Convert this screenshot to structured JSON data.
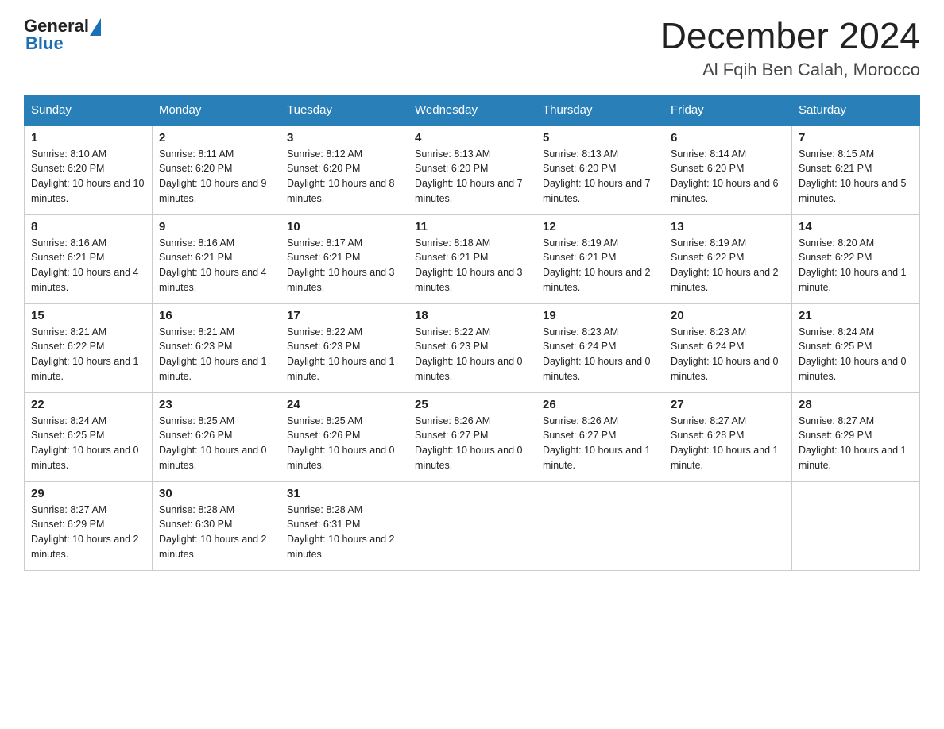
{
  "logo": {
    "general": "General",
    "blue": "Blue"
  },
  "header": {
    "month": "December 2024",
    "location": "Al Fqih Ben Calah, Morocco"
  },
  "weekdays": [
    "Sunday",
    "Monday",
    "Tuesday",
    "Wednesday",
    "Thursday",
    "Friday",
    "Saturday"
  ],
  "weeks": [
    [
      {
        "day": "1",
        "sunrise": "Sunrise: 8:10 AM",
        "sunset": "Sunset: 6:20 PM",
        "daylight": "Daylight: 10 hours and 10 minutes."
      },
      {
        "day": "2",
        "sunrise": "Sunrise: 8:11 AM",
        "sunset": "Sunset: 6:20 PM",
        "daylight": "Daylight: 10 hours and 9 minutes."
      },
      {
        "day": "3",
        "sunrise": "Sunrise: 8:12 AM",
        "sunset": "Sunset: 6:20 PM",
        "daylight": "Daylight: 10 hours and 8 minutes."
      },
      {
        "day": "4",
        "sunrise": "Sunrise: 8:13 AM",
        "sunset": "Sunset: 6:20 PM",
        "daylight": "Daylight: 10 hours and 7 minutes."
      },
      {
        "day": "5",
        "sunrise": "Sunrise: 8:13 AM",
        "sunset": "Sunset: 6:20 PM",
        "daylight": "Daylight: 10 hours and 7 minutes."
      },
      {
        "day": "6",
        "sunrise": "Sunrise: 8:14 AM",
        "sunset": "Sunset: 6:20 PM",
        "daylight": "Daylight: 10 hours and 6 minutes."
      },
      {
        "day": "7",
        "sunrise": "Sunrise: 8:15 AM",
        "sunset": "Sunset: 6:21 PM",
        "daylight": "Daylight: 10 hours and 5 minutes."
      }
    ],
    [
      {
        "day": "8",
        "sunrise": "Sunrise: 8:16 AM",
        "sunset": "Sunset: 6:21 PM",
        "daylight": "Daylight: 10 hours and 4 minutes."
      },
      {
        "day": "9",
        "sunrise": "Sunrise: 8:16 AM",
        "sunset": "Sunset: 6:21 PM",
        "daylight": "Daylight: 10 hours and 4 minutes."
      },
      {
        "day": "10",
        "sunrise": "Sunrise: 8:17 AM",
        "sunset": "Sunset: 6:21 PM",
        "daylight": "Daylight: 10 hours and 3 minutes."
      },
      {
        "day": "11",
        "sunrise": "Sunrise: 8:18 AM",
        "sunset": "Sunset: 6:21 PM",
        "daylight": "Daylight: 10 hours and 3 minutes."
      },
      {
        "day": "12",
        "sunrise": "Sunrise: 8:19 AM",
        "sunset": "Sunset: 6:21 PM",
        "daylight": "Daylight: 10 hours and 2 minutes."
      },
      {
        "day": "13",
        "sunrise": "Sunrise: 8:19 AM",
        "sunset": "Sunset: 6:22 PM",
        "daylight": "Daylight: 10 hours and 2 minutes."
      },
      {
        "day": "14",
        "sunrise": "Sunrise: 8:20 AM",
        "sunset": "Sunset: 6:22 PM",
        "daylight": "Daylight: 10 hours and 1 minute."
      }
    ],
    [
      {
        "day": "15",
        "sunrise": "Sunrise: 8:21 AM",
        "sunset": "Sunset: 6:22 PM",
        "daylight": "Daylight: 10 hours and 1 minute."
      },
      {
        "day": "16",
        "sunrise": "Sunrise: 8:21 AM",
        "sunset": "Sunset: 6:23 PM",
        "daylight": "Daylight: 10 hours and 1 minute."
      },
      {
        "day": "17",
        "sunrise": "Sunrise: 8:22 AM",
        "sunset": "Sunset: 6:23 PM",
        "daylight": "Daylight: 10 hours and 1 minute."
      },
      {
        "day": "18",
        "sunrise": "Sunrise: 8:22 AM",
        "sunset": "Sunset: 6:23 PM",
        "daylight": "Daylight: 10 hours and 0 minutes."
      },
      {
        "day": "19",
        "sunrise": "Sunrise: 8:23 AM",
        "sunset": "Sunset: 6:24 PM",
        "daylight": "Daylight: 10 hours and 0 minutes."
      },
      {
        "day": "20",
        "sunrise": "Sunrise: 8:23 AM",
        "sunset": "Sunset: 6:24 PM",
        "daylight": "Daylight: 10 hours and 0 minutes."
      },
      {
        "day": "21",
        "sunrise": "Sunrise: 8:24 AM",
        "sunset": "Sunset: 6:25 PM",
        "daylight": "Daylight: 10 hours and 0 minutes."
      }
    ],
    [
      {
        "day": "22",
        "sunrise": "Sunrise: 8:24 AM",
        "sunset": "Sunset: 6:25 PM",
        "daylight": "Daylight: 10 hours and 0 minutes."
      },
      {
        "day": "23",
        "sunrise": "Sunrise: 8:25 AM",
        "sunset": "Sunset: 6:26 PM",
        "daylight": "Daylight: 10 hours and 0 minutes."
      },
      {
        "day": "24",
        "sunrise": "Sunrise: 8:25 AM",
        "sunset": "Sunset: 6:26 PM",
        "daylight": "Daylight: 10 hours and 0 minutes."
      },
      {
        "day": "25",
        "sunrise": "Sunrise: 8:26 AM",
        "sunset": "Sunset: 6:27 PM",
        "daylight": "Daylight: 10 hours and 0 minutes."
      },
      {
        "day": "26",
        "sunrise": "Sunrise: 8:26 AM",
        "sunset": "Sunset: 6:27 PM",
        "daylight": "Daylight: 10 hours and 1 minute."
      },
      {
        "day": "27",
        "sunrise": "Sunrise: 8:27 AM",
        "sunset": "Sunset: 6:28 PM",
        "daylight": "Daylight: 10 hours and 1 minute."
      },
      {
        "day": "28",
        "sunrise": "Sunrise: 8:27 AM",
        "sunset": "Sunset: 6:29 PM",
        "daylight": "Daylight: 10 hours and 1 minute."
      }
    ],
    [
      {
        "day": "29",
        "sunrise": "Sunrise: 8:27 AM",
        "sunset": "Sunset: 6:29 PM",
        "daylight": "Daylight: 10 hours and 2 minutes."
      },
      {
        "day": "30",
        "sunrise": "Sunrise: 8:28 AM",
        "sunset": "Sunset: 6:30 PM",
        "daylight": "Daylight: 10 hours and 2 minutes."
      },
      {
        "day": "31",
        "sunrise": "Sunrise: 8:28 AM",
        "sunset": "Sunset: 6:31 PM",
        "daylight": "Daylight: 10 hours and 2 minutes."
      },
      null,
      null,
      null,
      null
    ]
  ]
}
